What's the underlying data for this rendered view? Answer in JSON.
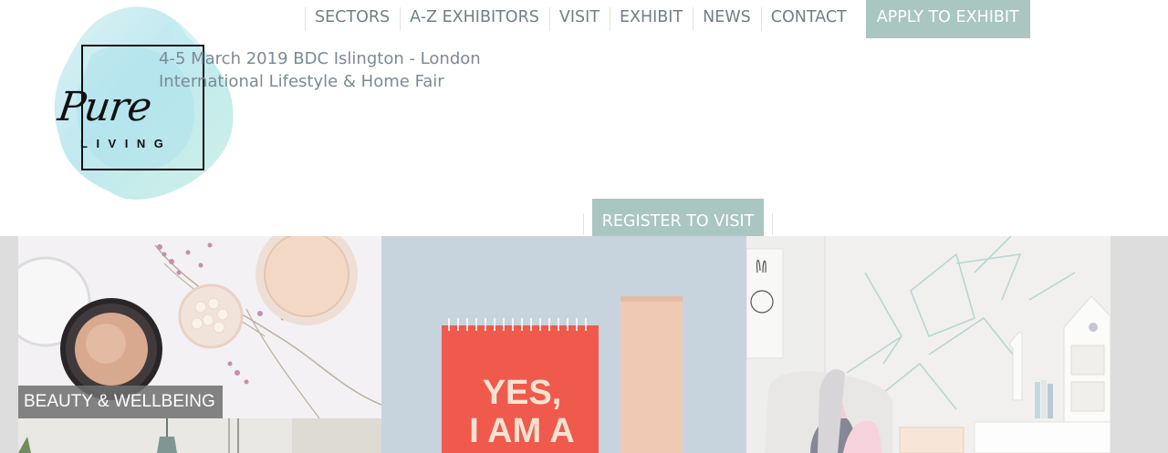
{
  "brand": {
    "logo_script": "Pure",
    "logo_sub": "LIVING"
  },
  "event": {
    "line1": "4-5 March 2019 BDC Islington - London",
    "line2": "International Lifestyle & Home Fair"
  },
  "nav": {
    "items": [
      {
        "label": "SECTORS"
      },
      {
        "label": "A-Z EXHIBITORS"
      },
      {
        "label": "VISIT"
      },
      {
        "label": "EXHIBIT"
      },
      {
        "label": "NEWS"
      },
      {
        "label": "CONTACT"
      }
    ],
    "apply_label": "APPLY TO EXHIBIT"
  },
  "register_label": "REGISTER TO VISIT",
  "gallery": {
    "tiles": [
      {
        "label": "BEAUTY & WELLBEING"
      }
    ],
    "notebook_text": [
      "YES,",
      "I AM A"
    ]
  },
  "colors": {
    "accent": "#a9c6c0",
    "nav_text": "#6e7f8c",
    "tagline_text": "#7b8a97",
    "notebook": "#ef5a4c"
  }
}
